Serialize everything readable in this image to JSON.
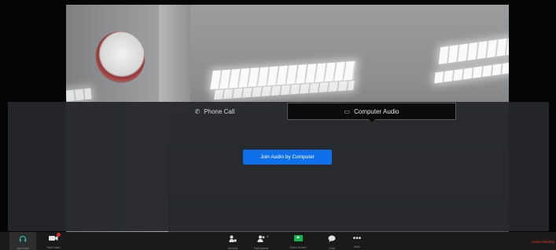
{
  "dialog": {
    "tabs": [
      {
        "label": "Phone Call",
        "icon": "phone-icon"
      },
      {
        "label": "Computer Audio",
        "icon": "computer-icon"
      }
    ],
    "join_button": "Join Audio by Computer"
  },
  "toolbar": {
    "items": [
      {
        "label": "Join Audio",
        "icon": "headphone-icon"
      },
      {
        "label": "Start Video",
        "icon": "video-camera-icon"
      },
      {
        "label": "Security",
        "icon": "security-icon"
      },
      {
        "label": "Participants",
        "icon": "participants-icon",
        "count": "1"
      },
      {
        "label": "Share Screen",
        "icon": "share-screen-icon"
      },
      {
        "label": "Chat",
        "icon": "chat-icon"
      },
      {
        "label": "More",
        "icon": "more-icon"
      }
    ],
    "leave_label": "Leave Meeting"
  },
  "colors": {
    "join_button": "#0e71eb",
    "share_screen": "#18b34a",
    "leave": "#e8363c",
    "audio_icon": "#2db8a2"
  }
}
